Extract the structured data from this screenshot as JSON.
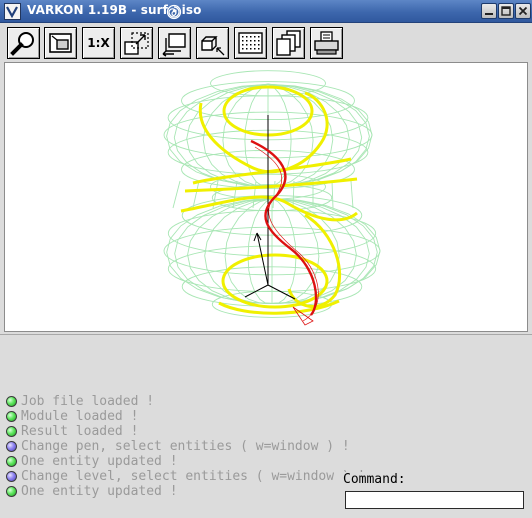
{
  "window": {
    "title": "VARKON 1.19B - surf - iso",
    "title_icon": "varkon-v-icon",
    "controls": [
      {
        "name": "minimize",
        "icon": "minimize-icon"
      },
      {
        "name": "maximize",
        "icon": "maximize-icon"
      },
      {
        "name": "close",
        "icon": "close-icon"
      }
    ]
  },
  "toolbar": {
    "buttons": [
      {
        "name": "zoom",
        "icon": "magnifier-icon"
      },
      {
        "name": "auto-scale",
        "icon": "auto-scale-icon"
      },
      {
        "name": "scale-1-x",
        "label": "1:X"
      },
      {
        "name": "enlarge",
        "icon": "enlarge-icon"
      },
      {
        "name": "previous-view",
        "icon": "previous-view-icon"
      },
      {
        "name": "perspective",
        "icon": "perspective-icon"
      },
      {
        "name": "grid",
        "icon": "grid-icon"
      },
      {
        "name": "duplicate-window",
        "icon": "duplicate-windows-icon"
      },
      {
        "name": "print",
        "icon": "printer-icon"
      }
    ]
  },
  "colors": {
    "wireframe": "#a8e6b4",
    "iso_curves": "#f0f000",
    "red_curve": "#dd1111",
    "axes": "#000000",
    "status_green": "#3ecf3e",
    "status_blue": "#7a6ee8",
    "message_text": "#9a9a9a"
  },
  "messages": [
    {
      "status": "green",
      "text": "Job file loaded !"
    },
    {
      "status": "green",
      "text": "Module loaded !"
    },
    {
      "status": "green",
      "text": "Result loaded !"
    },
    {
      "status": "blue",
      "text": "Change pen, select entities ( w=window  ) !"
    },
    {
      "status": "green",
      "text": "One entity updated !"
    },
    {
      "status": "blue",
      "text": "Change level, select entities ( w=window  ) !"
    },
    {
      "status": "green",
      "text": "One entity updated !"
    }
  ],
  "command": {
    "label": "Command:",
    "value": ""
  }
}
